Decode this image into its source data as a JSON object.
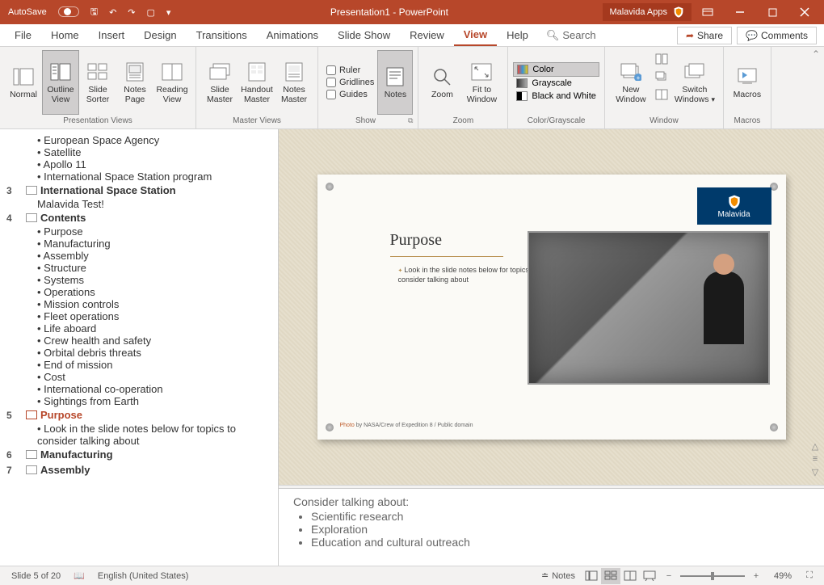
{
  "titlebar": {
    "autosave": "AutoSave",
    "title": "Presentation1 - PowerPoint",
    "app": "Malavida Apps"
  },
  "menu": {
    "file": "File",
    "home": "Home",
    "insert": "Insert",
    "design": "Design",
    "transitions": "Transitions",
    "animations": "Animations",
    "slideshow": "Slide Show",
    "review": "Review",
    "view": "View",
    "help": "Help",
    "search": "Search",
    "share": "Share",
    "comments": "Comments"
  },
  "ribbon": {
    "presViews": {
      "normal": "Normal",
      "outline": "Outline View",
      "sorter": "Slide Sorter",
      "notesPage": "Notes Page",
      "reading": "Reading View",
      "label": "Presentation Views"
    },
    "masterViews": {
      "slide": "Slide Master",
      "handout": "Handout Master",
      "notes": "Notes Master",
      "label": "Master Views"
    },
    "show": {
      "ruler": "Ruler",
      "gridlines": "Gridlines",
      "guides": "Guides",
      "notes": "Notes",
      "label": "Show"
    },
    "zoom": {
      "zoom": "Zoom",
      "fit": "Fit to Window",
      "label": "Zoom"
    },
    "color": {
      "color": "Color",
      "grayscale": "Grayscale",
      "bw": "Black and White",
      "label": "Color/Grayscale"
    },
    "window": {
      "new": "New Window",
      "switch": "Switch Windows",
      "label": "Window"
    },
    "macros": {
      "macros": "Macros",
      "label": "Macros"
    }
  },
  "outline": {
    "slide2_items": [
      "European Space Agency",
      "Satellite",
      "Apollo 11",
      "International Space Station program"
    ],
    "slide3": {
      "num": "3",
      "title": "International Space Station",
      "sub": "Malavida Test!"
    },
    "slide4": {
      "num": "4",
      "title": "Contents",
      "items": [
        "Purpose",
        "Manufacturing",
        "Assembly",
        "Structure",
        "Systems",
        "Operations",
        "Mission controls",
        "Fleet operations",
        "Life aboard",
        "Crew health and safety",
        "Orbital debris threats",
        "End of mission",
        "Cost",
        "International co-operation",
        "Sightings from Earth"
      ]
    },
    "slide5": {
      "num": "5",
      "title": "Purpose",
      "sub": "Look in the slide notes below for topics to consider talking about"
    },
    "slide6": {
      "num": "6",
      "title": "Manufacturing"
    },
    "slide7": {
      "num": "7",
      "title": "Assembly"
    }
  },
  "slide": {
    "title": "Purpose",
    "body": "Look in the slide notes below for topics to consider talking about",
    "logo": "Malavida",
    "credit_link": "Photo",
    "credit_rest": " by NASA/Crew of Expedition 8 / Public domain"
  },
  "notes": {
    "heading": "Consider talking about:",
    "items": [
      "Scientific research",
      "Exploration",
      "Education and cultural outreach"
    ]
  },
  "status": {
    "slide": "Slide 5 of 20",
    "lang": "English (United States)",
    "notes": "Notes",
    "zoom": "49%"
  }
}
